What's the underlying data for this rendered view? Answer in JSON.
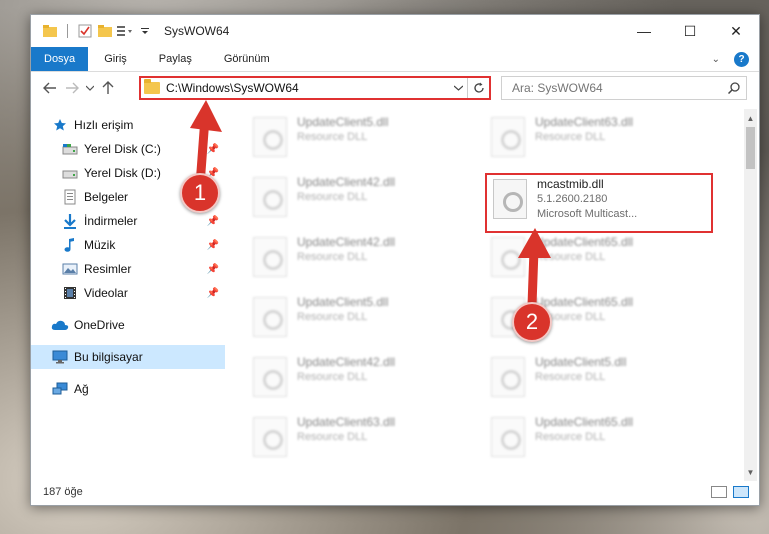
{
  "window": {
    "title": "SysWOW64",
    "controls": {
      "minimize": "—",
      "maximize": "☐",
      "close": "✕"
    }
  },
  "ribbon": {
    "tabs": [
      "Dosya",
      "Giriş",
      "Paylaş",
      "Görünüm"
    ],
    "help": "?"
  },
  "nav": {
    "address": "C:\\Windows\\SysWOW64",
    "search_placeholder": "Ara: SysWOW64"
  },
  "sidebar": {
    "items": [
      {
        "label": "Hızlı erişim",
        "icon": "star-icon",
        "pinned": false
      },
      {
        "label": "Yerel Disk (C:)",
        "icon": "drive-icon",
        "pinned": true
      },
      {
        "label": "Yerel Disk (D:)",
        "icon": "drive-icon",
        "pinned": true
      },
      {
        "label": "Belgeler",
        "icon": "documents-icon",
        "pinned": true
      },
      {
        "label": "İndirmeler",
        "icon": "download-icon",
        "pinned": true
      },
      {
        "label": "Müzik",
        "icon": "music-icon",
        "pinned": true
      },
      {
        "label": "Resimler",
        "icon": "pictures-icon",
        "pinned": true
      },
      {
        "label": "Videolar",
        "icon": "video-icon",
        "pinned": true
      },
      {
        "label": "OneDrive",
        "icon": "cloud-icon",
        "pinned": false
      },
      {
        "label": "Bu bilgisayar",
        "icon": "computer-icon",
        "pinned": false
      },
      {
        "label": "Ağ",
        "icon": "network-icon",
        "pinned": false
      }
    ]
  },
  "files": {
    "left": [
      {
        "name": "UpdateClient5.dll",
        "sub": "Resource DLL"
      },
      {
        "name": "UpdateClient42.dll",
        "sub": "Resource DLL"
      },
      {
        "name": "UpdateClient42.dll",
        "sub": "Resource DLL"
      },
      {
        "name": "UpdateClient5.dll",
        "sub": "Resource DLL"
      },
      {
        "name": "UpdateClient42.dll",
        "sub": "Resource DLL"
      },
      {
        "name": "UpdateClient63.dll",
        "sub": "Resource DLL"
      }
    ],
    "right": [
      {
        "name": "UpdateClient63.dll",
        "sub": "Resource DLL"
      },
      {
        "name": "mcastmib.dll",
        "sub": "5.1.2600.2180",
        "sub2": "Microsoft Multicast..."
      },
      {
        "name": "UpdateClient65.dll",
        "sub": "Resource DLL"
      },
      {
        "name": "UpdateClient65.dll",
        "sub": "Resource DLL"
      },
      {
        "name": "UpdateClient5.dll",
        "sub": "Resource DLL"
      },
      {
        "name": "UpdateClient65.dll",
        "sub": "Resource DLL"
      }
    ]
  },
  "status": {
    "count": "187 öğe"
  },
  "annotations": {
    "step1": "1",
    "step2": "2",
    "color": "#e03131"
  }
}
